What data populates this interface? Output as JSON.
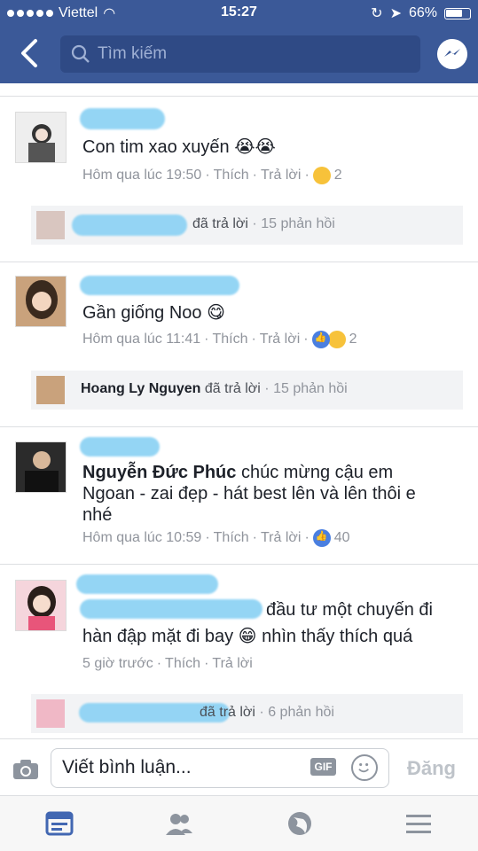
{
  "status": {
    "carrier": "Viettel",
    "time": "15:27",
    "battery": "66%"
  },
  "header": {
    "search_placeholder": "Tìm kiếm"
  },
  "comments": [
    {
      "text": "Con tim xao xuyến 😭😭",
      "time": "Hôm qua lúc 19:50",
      "like": "Thích",
      "reply": "Trả lời",
      "reaction_count": "2",
      "reply_summary": {
        "action": "đã trả lời",
        "count": "15 phản hồi"
      }
    },
    {
      "text": "Gần giống Noo 😋",
      "time": "Hôm qua lúc 11:41",
      "like": "Thích",
      "reply": "Trả lời",
      "reaction_count": "2",
      "reply_summary": {
        "name": "Hoang Ly Nguyen",
        "action": "đã trả lời",
        "count": "15 phản hồi"
      }
    },
    {
      "name": "Nguyễn Đức Phúc",
      "text": "chúc mừng cậu em",
      "text2": "Ngoan - zai đẹp - hát best lên và lên thôi e",
      "text3": "nhé",
      "time": "Hôm qua lúc 10:59",
      "like": "Thích",
      "reply": "Trả lời",
      "reaction_count": "40"
    },
    {
      "text": "đầu tư một chuyến đi",
      "text2": "hàn đập mặt đi bay 😁 nhìn thấy thích quá",
      "time": "5 giờ trước",
      "like": "Thích",
      "reply": "Trả lời",
      "reply_summary": {
        "action": "đã trả lời",
        "count": "6 phản hồi"
      }
    }
  ],
  "composer": {
    "placeholder": "Viết bình luận...",
    "gif": "GIF",
    "post": "Đăng"
  },
  "colors": {
    "brand": "#3b5998",
    "meta": "#90949c",
    "like": "#4a7fe0"
  }
}
